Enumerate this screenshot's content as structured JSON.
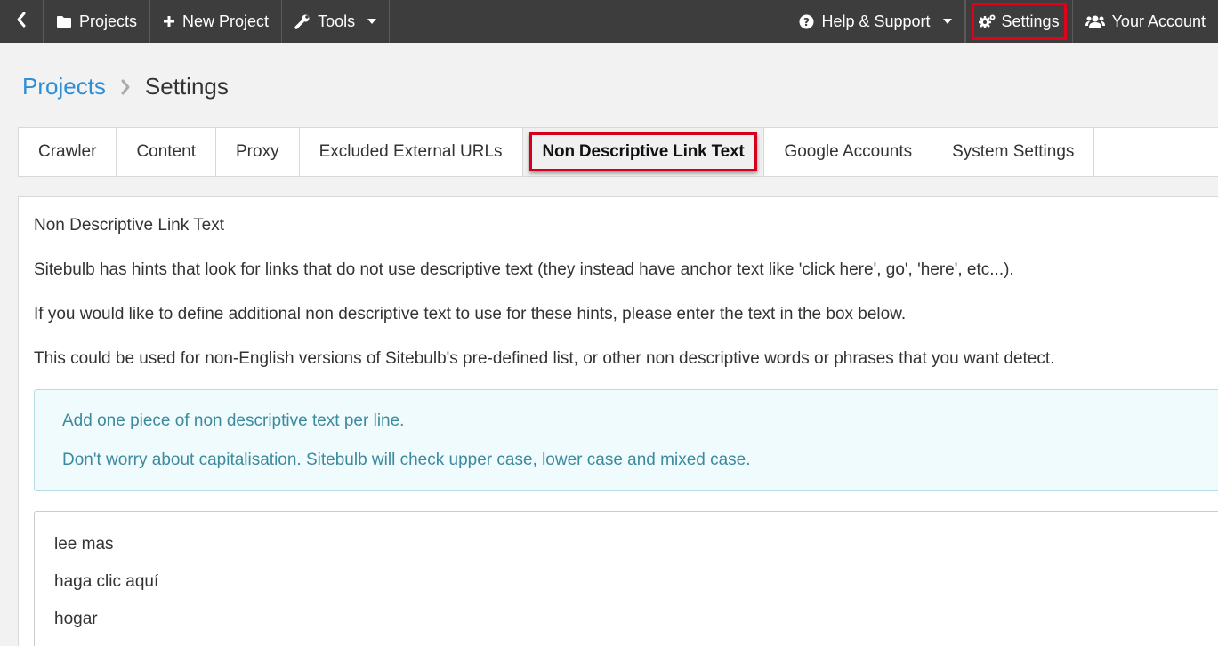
{
  "topbar": {
    "projects_label": "Projects",
    "new_project_label": "New Project",
    "tools_label": "Tools",
    "help_label": "Help & Support",
    "settings_label": "Settings",
    "account_label": "Your Account"
  },
  "breadcrumb": {
    "root": "Projects",
    "current": "Settings"
  },
  "tabs": [
    {
      "label": "Crawler"
    },
    {
      "label": "Content"
    },
    {
      "label": "Proxy"
    },
    {
      "label": "Excluded External URLs"
    },
    {
      "label": "Non Descriptive Link Text"
    },
    {
      "label": "Google Accounts"
    },
    {
      "label": "System Settings"
    }
  ],
  "panel": {
    "heading": "Non Descriptive Link Text",
    "para1": "Sitebulb has hints that look for links that do not use descriptive text (they instead have anchor text like 'click here', go', 'here', etc...).",
    "para2": "If you would like to define additional non descriptive text to use for these hints, please enter the text in the box below.",
    "para3": "This could be used for non-English versions of Sitebulb's pre-defined list, or other non descriptive words or phrases that you want detect.",
    "info1": "Add one piece of non descriptive text per line.",
    "info2": "Don't worry about capitalisation. Sitebulb will check upper case, lower case and mixed case.",
    "lines": [
      "lee mas",
      "haga clic aquí",
      "hogar"
    ]
  },
  "colors": {
    "topbar_bg": "#3d3d3d",
    "link": "#2e8fd6",
    "highlight": "#e3001b",
    "info_text": "#3b8a9e"
  }
}
